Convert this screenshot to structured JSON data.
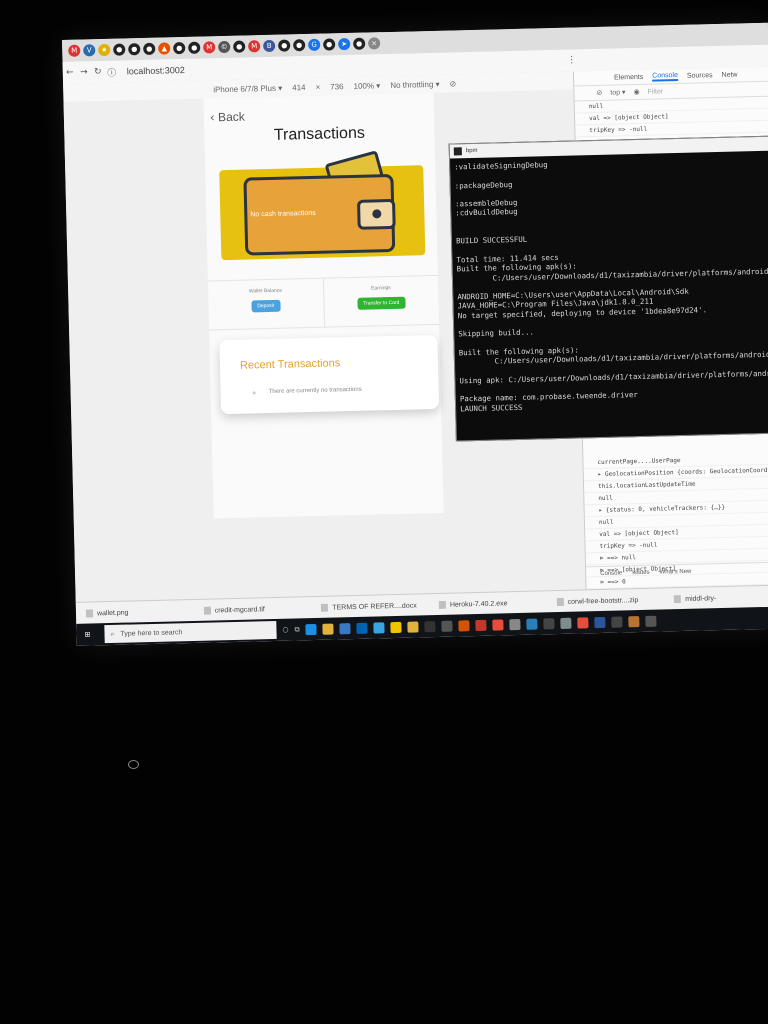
{
  "browser": {
    "url": "localhost:3002",
    "device": "iPhone 6/7/8 Plus ▾",
    "width": "414",
    "height": "736",
    "zoom": "100% ▾",
    "throttle": "No throttling ▾"
  },
  "app": {
    "back_label": "Back",
    "title": "Transactions",
    "banner_text": "No cash transactions",
    "wallet_balance_label": "Wallet Balance",
    "deposit_label": "Deposit",
    "earnings_label": "Earnings",
    "transfer_label": "Transfer to Card",
    "recent_title": "Recent Transactions",
    "empty_text": "There are currently no transactions"
  },
  "devtools": {
    "tabs": [
      "Elements",
      "Console",
      "Sources",
      "Netw"
    ],
    "context": "top ▾",
    "filter_placeholder": "Filter",
    "lines_top": [
      "null",
      "val => [object Object]",
      "tripKey => -null"
    ],
    "lines_bottom": [
      "currentPage....UserPage",
      "▸ GeolocationPosition {coords: GeolocationCoordinates",
      "this.locationLastUpdateTime",
      "null",
      "▸ {status: 0, vehicleTrackers: {…}}",
      "null",
      "val => [object Object]",
      "tripKey => -null",
      "⊳ ==> null",
      "⊳ ==> [object Object]",
      "⊳ ==> 0"
    ],
    "drawer_tabs": [
      "Console",
      "Issues",
      "What's New"
    ]
  },
  "terminal": {
    "title": "bpm",
    "lines": [
      ":validateSigningDebug",
      "",
      ":packageDebug",
      "",
      ":assembleDebug",
      ":cdvBuildDebug",
      "",
      "",
      "BUILD SUCCESSFUL",
      "",
      "Total time: 11.414 secs",
      "Built the following apk(s):",
      "        C:/Users/user/Downloads/d1/taxizambia/driver/platforms/android",
      "",
      "ANDROID_HOME=C:\\Users\\user\\AppData\\Local\\Android\\Sdk",
      "JAVA_HOME=C:\\Program Files\\Java\\jdk1.8.0_211",
      "No target specified, deploying to device '1bdea8e97d24'.",
      "",
      "Skipping build...",
      "",
      "Built the following apk(s):",
      "        C:/Users/user/Downloads/d1/taxizambia/driver/platforms/android",
      "",
      "Using apk: C:/Users/user/Downloads/d1/taxizambia/driver/platforms/andro",
      "",
      "Package name: com.probase.tweende.driver",
      "LAUNCH SUCCESS"
    ]
  },
  "downloads": [
    "wallet.png",
    "credit-mgcard.tif",
    "TERMS OF REFER....docx",
    "Heroku-7.40.2.exe",
    "corwl-free-bootstr....zip",
    "middl-dry-"
  ],
  "taskbar": {
    "search_placeholder": "Type here to search"
  },
  "colors": {
    "banner": "#e7c10f",
    "wallet": "#e8a23a",
    "deposit": "#4aa3df",
    "transfer": "#2fb52f",
    "accent_title": "#e0a52a",
    "terminal_bg": "#0c0c0c"
  }
}
